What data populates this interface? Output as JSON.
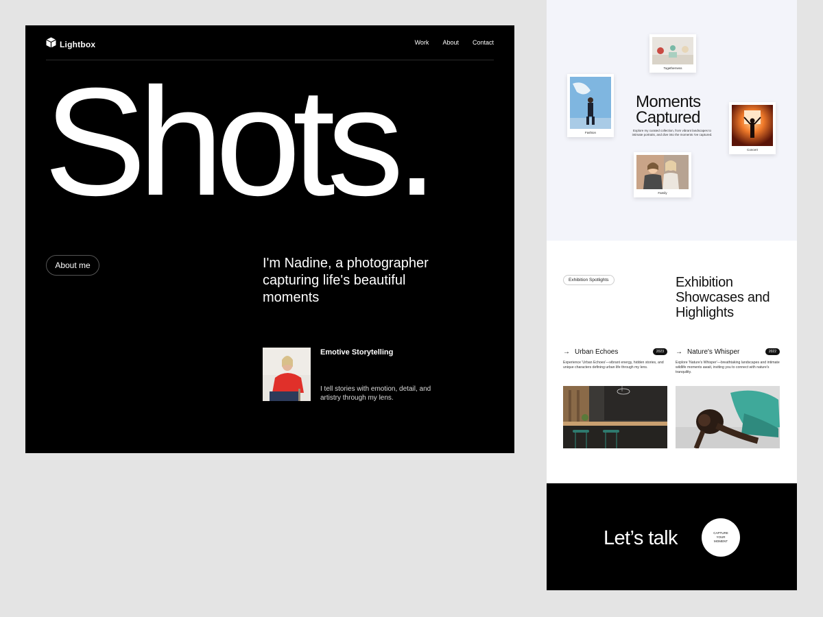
{
  "hero": {
    "logo_text": "Lightbox",
    "nav": [
      "Work",
      "About",
      "Contact"
    ],
    "headline": "Shots.",
    "about_button": "About me",
    "intro": "I'm Nadine, a photographer capturing life's beautiful moments",
    "card_title": "Emotive Storytelling",
    "card_description": "I tell stories with emotion, detail, and artistry through my lens."
  },
  "moments": {
    "title_line1": "Moments",
    "title_line2": "Captured",
    "description": "Explore my curated collection, from vibrant landscapes to intimate portraits, and dive into the moments I've captured.",
    "photos": [
      {
        "caption": "Togetherness"
      },
      {
        "caption": "Fashion"
      },
      {
        "caption": "Concert"
      },
      {
        "caption": "Family"
      }
    ]
  },
  "exhibition": {
    "tag": "Exhibition Spotlights",
    "title": "Exhibition Showcases and Highlights",
    "items": [
      {
        "name": "Urban Echoes",
        "year": "2023",
        "description": "Experience 'Urban Echoes'—vibrant energy, hidden stories, and unique characters defining urban life through my lens."
      },
      {
        "name": "Nature's Whisper",
        "year": "2022",
        "description": "Explore 'Nature's Whisper'—breathtaking landscapes and intimate wildlife moments await, inviting you to connect with nature's tranquility."
      }
    ]
  },
  "talk": {
    "title": "Let’s talk",
    "circle_text": "CAPTURE YOUR MOMENT"
  }
}
